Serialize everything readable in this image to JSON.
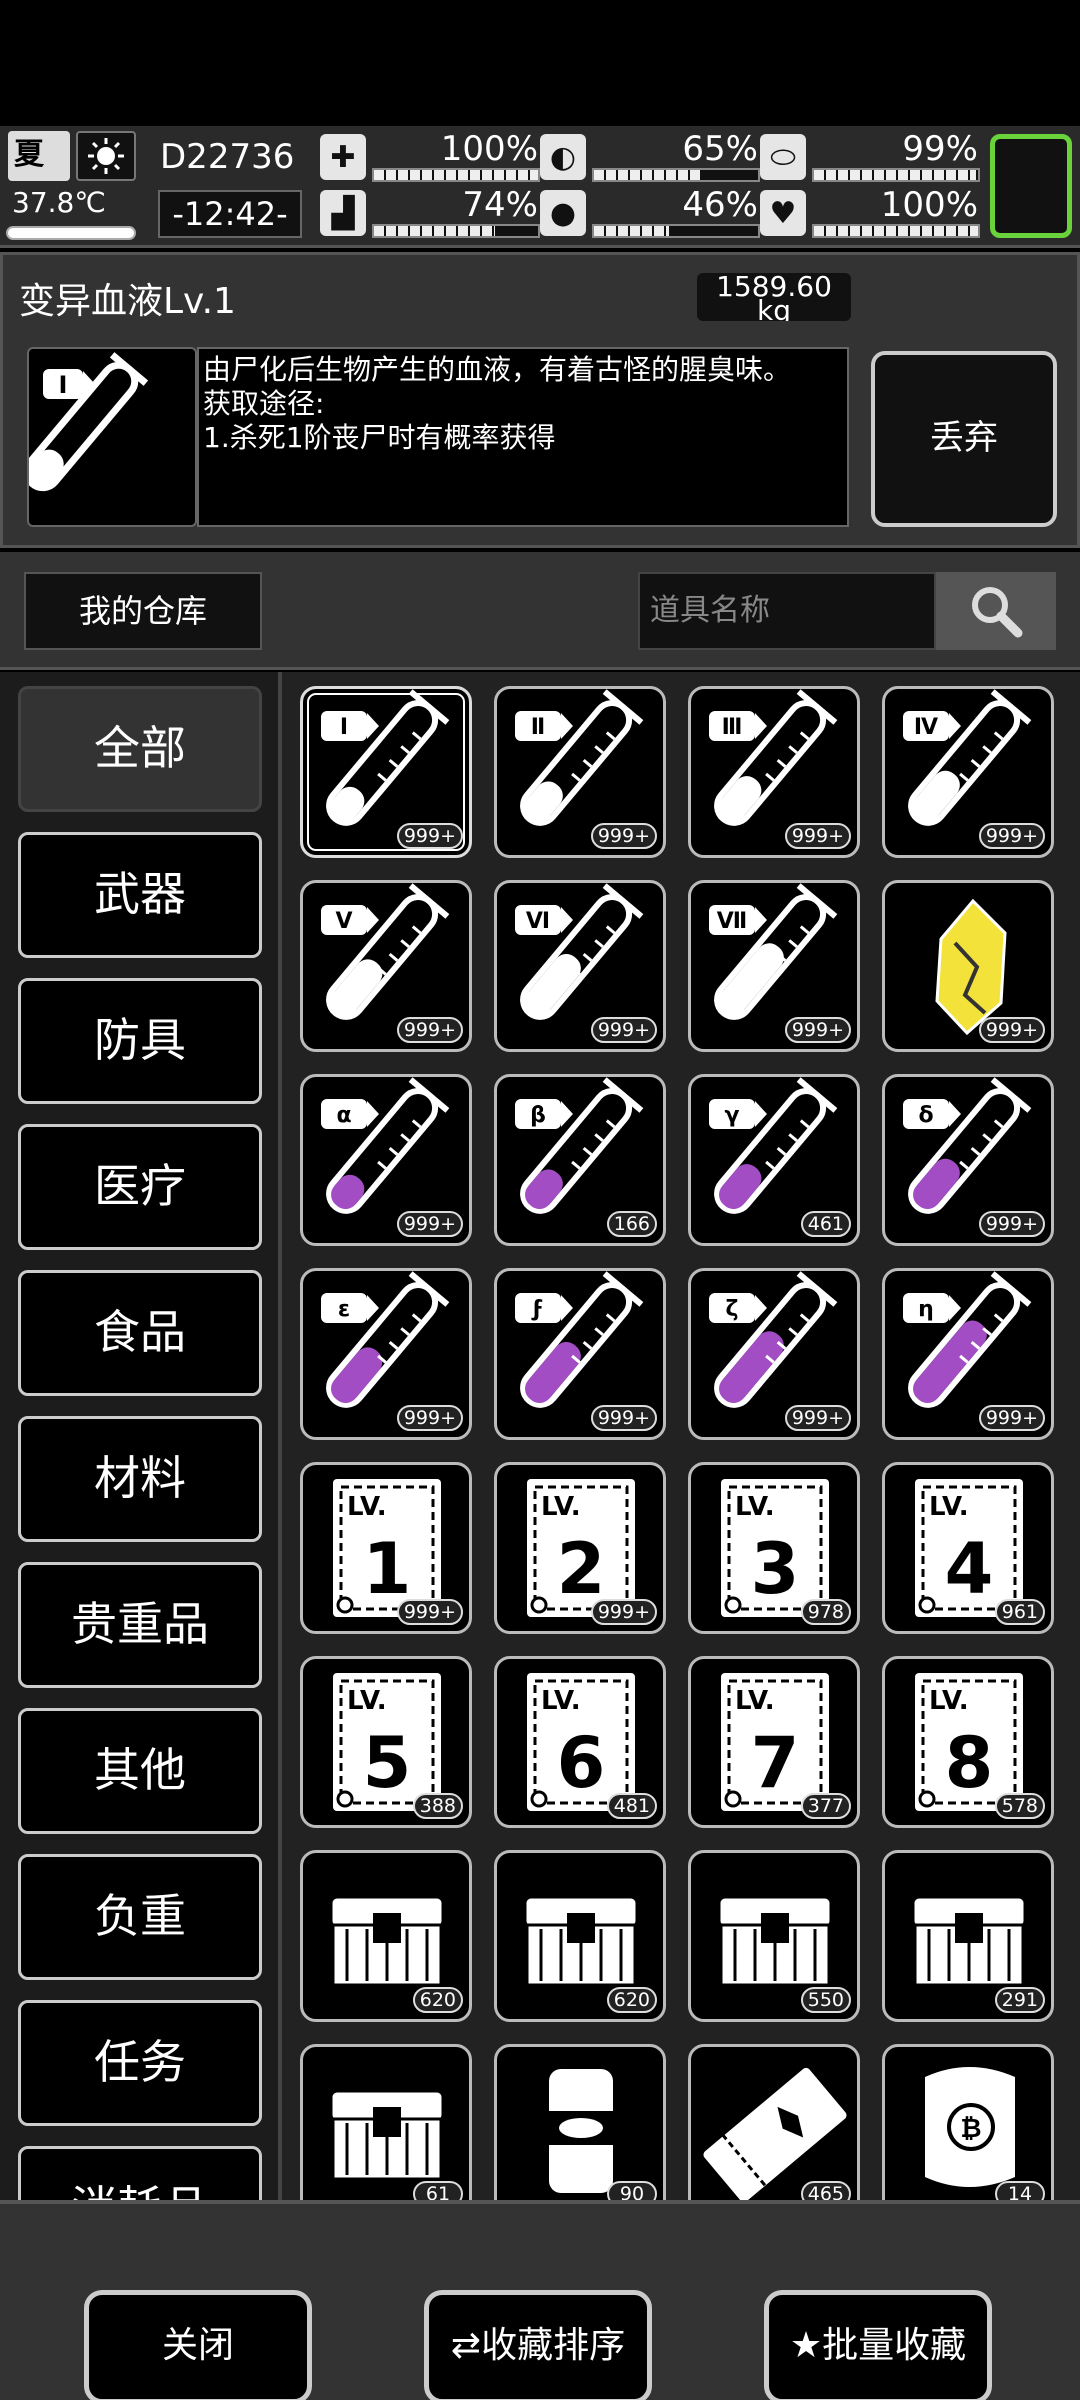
{
  "status": {
    "season": "夏",
    "weather_icon": "sun-icon",
    "temperature": "37.8℃",
    "day": "D22736",
    "time": "-12:42-",
    "stats": [
      {
        "name": "health",
        "icon": "medkit-icon",
        "value": "100%",
        "level": 1.0
      },
      {
        "name": "hunger",
        "icon": "stomach-icon",
        "value": "65%",
        "level": 0.65
      },
      {
        "name": "immunity",
        "icon": "pill-icon",
        "value": "99%",
        "level": 0.99
      },
      {
        "name": "stamina",
        "icon": "boot-icon",
        "value": "74%",
        "level": 0.74
      },
      {
        "name": "thirst",
        "icon": "water-drop-icon",
        "value": "46%",
        "level": 0.46
      },
      {
        "name": "mood",
        "icon": "heart-icon",
        "value": "100%",
        "level": 1.0
      }
    ]
  },
  "detail": {
    "title": "变异血液Lv.1",
    "weight": "1589.60 kg",
    "description_lines": [
      "由尸化后生物产生的血液，有着古怪的腥臭味。",
      "获取途径:",
      "1.杀死1阶丧尸时有概率获得"
    ],
    "discard_label": "丢弃"
  },
  "warehouse": {
    "label": "我的仓库",
    "search_placeholder": "道具名称"
  },
  "categories": [
    "全部",
    "武器",
    "防具",
    "医疗",
    "食品",
    "材料",
    "贵重品",
    "其他",
    "负重",
    "任务",
    "消耗品"
  ],
  "items": [
    {
      "kind": "tube",
      "label": "Ⅰ",
      "liquid": "white",
      "fill": 0.25,
      "count": "999+"
    },
    {
      "kind": "tube",
      "label": "Ⅱ",
      "liquid": "white",
      "fill": 0.3,
      "count": "999+"
    },
    {
      "kind": "tube",
      "label": "Ⅲ",
      "liquid": "white",
      "fill": 0.35,
      "count": "999+"
    },
    {
      "kind": "tube",
      "label": "Ⅳ",
      "liquid": "white",
      "fill": 0.4,
      "count": "999+"
    },
    {
      "kind": "tube",
      "label": "Ⅴ",
      "liquid": "white",
      "fill": 0.45,
      "count": "999+"
    },
    {
      "kind": "tube",
      "label": "Ⅵ",
      "liquid": "white",
      "fill": 0.5,
      "count": "999+"
    },
    {
      "kind": "tube",
      "label": "Ⅶ",
      "liquid": "white",
      "fill": 0.6,
      "count": "999+"
    },
    {
      "kind": "crystal",
      "count": "999+"
    },
    {
      "kind": "tube",
      "label": "α",
      "liquid": "purple",
      "fill": 0.25,
      "count": "999+"
    },
    {
      "kind": "tube",
      "label": "β",
      "liquid": "purple",
      "fill": 0.3,
      "count": "166"
    },
    {
      "kind": "tube",
      "label": "γ",
      "liquid": "purple",
      "fill": 0.35,
      "count": "461"
    },
    {
      "kind": "tube",
      "label": "δ",
      "liquid": "purple",
      "fill": 0.4,
      "count": "999+"
    },
    {
      "kind": "tube",
      "label": "ε",
      "liquid": "purple",
      "fill": 0.45,
      "count": "999+"
    },
    {
      "kind": "tube",
      "label": "ϝ",
      "liquid": "purple",
      "fill": 0.5,
      "count": "999+"
    },
    {
      "kind": "tube",
      "label": "ζ",
      "liquid": "purple",
      "fill": 0.6,
      "count": "999+"
    },
    {
      "kind": "tube",
      "label": "η",
      "liquid": "purple",
      "fill": 0.7,
      "count": "999+"
    },
    {
      "kind": "card",
      "level": "1",
      "count": "999+"
    },
    {
      "kind": "card",
      "level": "2",
      "count": "999+"
    },
    {
      "kind": "card",
      "level": "3",
      "count": "978"
    },
    {
      "kind": "card",
      "level": "4",
      "count": "961"
    },
    {
      "kind": "card",
      "level": "5",
      "count": "388"
    },
    {
      "kind": "card",
      "level": "6",
      "count": "481"
    },
    {
      "kind": "card",
      "level": "7",
      "count": "377"
    },
    {
      "kind": "card",
      "level": "8",
      "count": "578"
    },
    {
      "kind": "chest",
      "count": "620"
    },
    {
      "kind": "chest",
      "count": "620"
    },
    {
      "kind": "chest",
      "count": "550"
    },
    {
      "kind": "chest",
      "count": "291"
    },
    {
      "kind": "chest",
      "count": "61"
    },
    {
      "kind": "can",
      "count": "90"
    },
    {
      "kind": "ticket",
      "count": "465"
    },
    {
      "kind": "scroll",
      "count": "14"
    }
  ],
  "labels": {
    "card_prefix": "LV."
  },
  "bottom": {
    "close_label": "关闭",
    "sort_label": "收藏排序",
    "batch_label": "批量收藏"
  },
  "colors": {
    "accent_green": "#6ad23a",
    "purple_liquid": "#a24dc4",
    "crystal_yellow": "#f2e23a"
  }
}
